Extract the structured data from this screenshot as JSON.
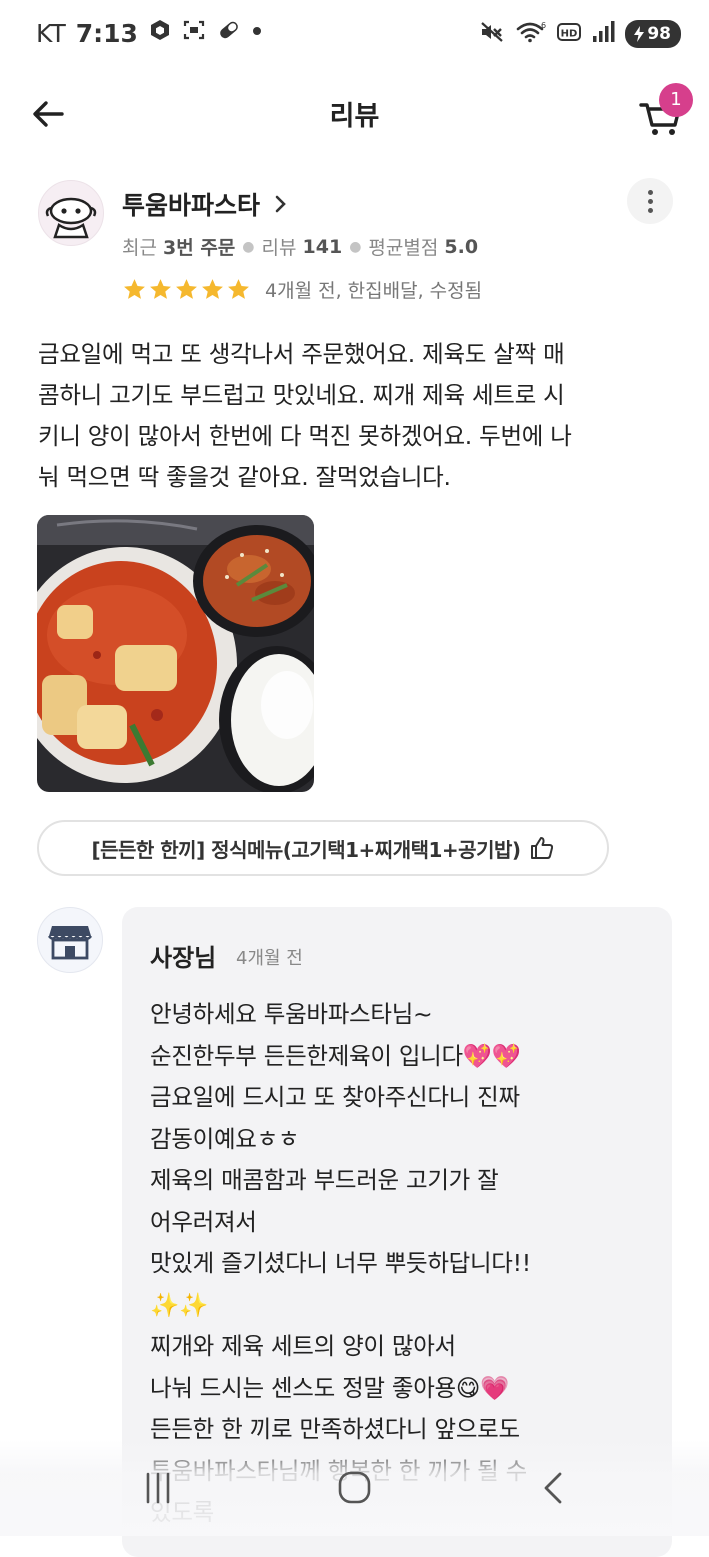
{
  "status_bar": {
    "carrier": "KT",
    "time": "7:13",
    "battery": "98"
  },
  "header": {
    "title": "리뷰",
    "cart_count": "1"
  },
  "reviewer": {
    "name": "투움바파스타",
    "stat_recent": "최근",
    "stat_orders": "3번 주문",
    "stat_reviews_label": "리뷰",
    "stat_reviews_count": "141",
    "stat_avg_label": "평균별점",
    "stat_avg_value": "5.0",
    "rating": 5,
    "meta": "4개월 전, 한집배달, 수정됨"
  },
  "review": {
    "text": "금요일에 먹고 또 생각나서 주문했어요. 제육도 살짝 매\n콤하니 고기도 부드럽고 맛있네요. 찌개 제육 세트로 시\n키니 양이 많아서 한번에 다 먹진 못하겠어요. 두번에 나\n눠 먹으면 딱 좋을것 같아요. 잘먹었습니다."
  },
  "menu_item": {
    "label": "[든든한 한끼] 정식메뉴(고기택1+찌개택1+공기밥)"
  },
  "owner_reply": {
    "author": "사장님",
    "time": "4개월 전",
    "text": "안녕하세요 투움바파스타님~\n순진한두부 든든한제육이 입니다💖💖\n금요일에 드시고 또 찾아주신다니 진짜\n감동이예요ㅎㅎ\n제육의 매콤함과 부드러운 고기가 잘\n어우러져서\n맛있게 즐기셨다니 너무 뿌듯하답니다!!\n✨✨\n찌개와 제육 세트의 양이 많아서\n나눠 드시는 센스도 정말 좋아용😋💗\n든든한 한 끼로 만족하셨다니 앞으로도\n투움바파스타님께 행복한 한 끼가 될 수\n있도록"
  },
  "colors": {
    "accent": "#d63f8c",
    "star": "#f5b82e",
    "reply_bg": "#f3f3f5"
  }
}
